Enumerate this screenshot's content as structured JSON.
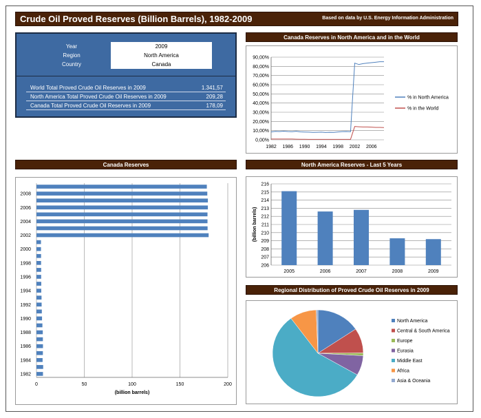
{
  "header": {
    "title": "Crude Oil Proved Reserves (Billion Barrels), 1982-2009",
    "source": "Based on data by U.S. Energy Information Administration"
  },
  "filters": {
    "labels": [
      "Year",
      "Region",
      "Country"
    ],
    "values": [
      "2009",
      "North America",
      "Canada"
    ]
  },
  "totals": [
    {
      "label": "World Total Proved Crude Oil Reserves in 2009",
      "value": "1.341,57"
    },
    {
      "label": "North America Total Proved Crude Oil Reserves in 2009",
      "value": "209,28"
    },
    {
      "label": "Canada Total Proved Crude Oil Reserves in 2009",
      "value": "178,09"
    }
  ],
  "colors": {
    "banner": "#4a2208",
    "panel_blue": "#3e6aa2",
    "bar_blue": "#4f81bd",
    "line_na": "#4f81bd",
    "line_world": "#c0504d"
  },
  "chart_data": [
    {
      "type": "line",
      "title": "Canada Reserves in North America and in the World",
      "x": [
        1982,
        1983,
        1984,
        1985,
        1986,
        1987,
        1988,
        1989,
        1990,
        1991,
        1992,
        1993,
        1994,
        1995,
        1996,
        1997,
        1998,
        1999,
        2000,
        2001,
        2002,
        2003,
        2004,
        2005,
        2006,
        2007,
        2008,
        2009
      ],
      "x_tick_labels": [
        "1982",
        "1986",
        "1990",
        "1994",
        "1998",
        "2002",
        "2006"
      ],
      "series": [
        {
          "name": "% in North America",
          "color": "#4f81bd",
          "values": [
            8.5,
            9.2,
            9.0,
            9.4,
            9.0,
            8.8,
            9.3,
            8.6,
            8.4,
            8.3,
            8.1,
            8.2,
            8.3,
            8.0,
            8.2,
            8.1,
            8.5,
            8.9,
            9.0,
            8.8,
            83.5,
            82.0,
            83.0,
            83.5,
            84.0,
            84.5,
            85.0,
            85.0
          ]
        },
        {
          "name": "% in the World",
          "color": "#c0504d",
          "values": [
            0.8,
            0.8,
            0.8,
            0.8,
            0.8,
            0.8,
            0.7,
            0.6,
            0.6,
            0.5,
            0.5,
            0.5,
            0.5,
            0.5,
            0.5,
            0.5,
            0.5,
            0.5,
            0.5,
            0.5,
            14.5,
            14.2,
            14.0,
            14.0,
            13.8,
            13.5,
            13.5,
            13.3
          ]
        }
      ],
      "ylim": [
        0,
        90
      ],
      "y_ticks": [
        "0,00%",
        "10,00%",
        "20,00%",
        "30,00%",
        "40,00%",
        "50,00%",
        "60,00%",
        "70,00%",
        "80,00%",
        "90,00%"
      ],
      "legend": "right"
    },
    {
      "type": "bar",
      "orientation": "horizontal",
      "title": "Canada Reserves",
      "categories": [
        1982,
        1983,
        1984,
        1985,
        1986,
        1987,
        1988,
        1989,
        1990,
        1991,
        1992,
        1993,
        1994,
        1995,
        1996,
        1997,
        1998,
        1999,
        2000,
        2001,
        2002,
        2003,
        2004,
        2005,
        2006,
        2007,
        2008,
        2009
      ],
      "category_tick_labels": [
        "1982",
        "1984",
        "1986",
        "1988",
        "1990",
        "1992",
        "1994",
        "1996",
        "1998",
        "2000",
        "2002",
        "2004",
        "2006",
        "2008"
      ],
      "values": [
        6.8,
        7.0,
        6.4,
        6.7,
        6.8,
        6.7,
        6.6,
        6.2,
        5.8,
        5.6,
        5.4,
        5.3,
        5.0,
        5.0,
        4.9,
        4.9,
        4.8,
        4.8,
        4.7,
        4.7,
        180.0,
        178.9,
        178.8,
        178.8,
        179.2,
        179.2,
        178.6,
        178.1
      ],
      "xlabel": "(billion barrels)",
      "xlim": [
        0,
        200
      ],
      "x_ticks": [
        "0",
        "50",
        "100",
        "150",
        "200"
      ]
    },
    {
      "type": "bar",
      "title": "North America Reserves - Last 5 Years",
      "categories": [
        "2005",
        "2006",
        "2007",
        "2008",
        "2009"
      ],
      "values": [
        215.1,
        212.6,
        212.8,
        209.3,
        209.2
      ],
      "ylabel": "(billion barrels)",
      "ylim": [
        206,
        216
      ],
      "y_ticks": [
        "206",
        "207",
        "208",
        "209",
        "210",
        "211",
        "212",
        "213",
        "214",
        "215",
        "216"
      ]
    },
    {
      "type": "pie",
      "title": "Regional Distribution of Proved Crude Oil Reserves in 2009",
      "legend": "right",
      "slices": [
        {
          "label": "North America",
          "value": 15.6,
          "color": "#4f81bd"
        },
        {
          "label": "Central & South America",
          "value": 9.3,
          "color": "#c0504d"
        },
        {
          "label": "Europe",
          "value": 1.0,
          "color": "#9bbb59"
        },
        {
          "label": "Eurasia",
          "value": 7.4,
          "color": "#8064a2"
        },
        {
          "label": "Middle East",
          "value": 56.6,
          "color": "#4bacc6"
        },
        {
          "label": "Africa",
          "value": 9.5,
          "color": "#f79646"
        },
        {
          "label": "Asia & Oceania",
          "value": 0.6,
          "color": "#93a9cf"
        }
      ]
    }
  ]
}
